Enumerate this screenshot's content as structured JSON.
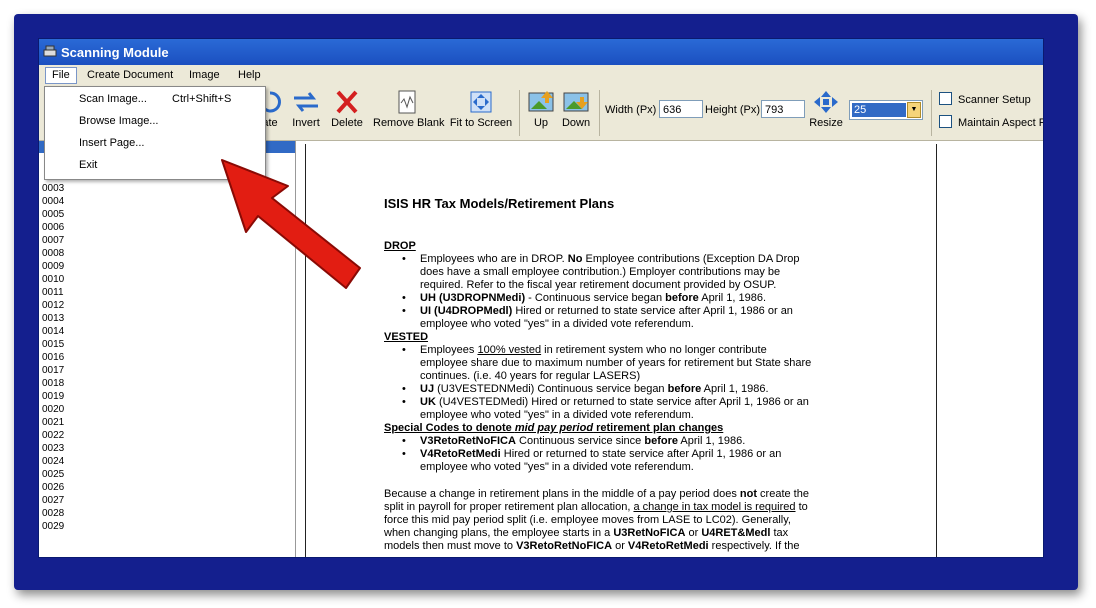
{
  "window": {
    "title": "Scanning Module"
  },
  "menu": {
    "file": "File",
    "create_document": "Create Document",
    "image": "Image",
    "help": "Help"
  },
  "file_menu": {
    "scan_image": "Scan Image...",
    "scan_image_shortcut": "Ctrl+Shift+S",
    "browse_image": "Browse Image...",
    "insert_page": "Insert Page...",
    "exit": "Exit"
  },
  "toolbar": {
    "rotate_partial": "ate",
    "invert": "Invert",
    "delete": "Delete",
    "remove_blank": "Remove Blank",
    "fit_to_screen": "Fit to Screen",
    "up": "Up",
    "down": "Down",
    "width_label": "Width (Px)",
    "width_value": "636",
    "height_label": "Height (Px)",
    "height_value": "793",
    "resize": "Resize",
    "zoom_value": "25",
    "scanner_setup": "Scanner Setup",
    "maintain_aspect": "Maintain Aspect F"
  },
  "page_list": [
    "0003",
    "0004",
    "0005",
    "0006",
    "0007",
    "0008",
    "0009",
    "0010",
    "0011",
    "0012",
    "0013",
    "0014",
    "0015",
    "0016",
    "0017",
    "0018",
    "0019",
    "0020",
    "0021",
    "0022",
    "0023",
    "0024",
    "0025",
    "0026",
    "0027",
    "0028",
    "0029"
  ],
  "document": {
    "title": "ISIS HR Tax Models/Retirement Plans",
    "drop_heading": "DROP",
    "drop_b1_a": "Employees who are in DROP.  ",
    "drop_b1_bold": "No",
    "drop_b1_b": " Employee contributions (Exception DA Drop",
    "drop_b1_l2": "does have a small employee contribution.)  Employer contributions may be",
    "drop_b1_l3": "required.  Refer to the fiscal year retirement document provided by OSUP.",
    "drop_b2_bold": "UH (U3DROPNMedi)",
    "drop_b2_a": " - Continuous service began ",
    "drop_b2_bold2": "before",
    "drop_b2_b": " April 1, 1986.",
    "drop_b3_bold": "UI (U4DROPMedl)",
    "drop_b3_a": " Hired or returned to state service after April 1, 1986 or an",
    "drop_b3_l2": "employee who voted \"yes\" in a divided vote referendum.",
    "vested_heading": "VESTED",
    "vested_b1_a": "Employees ",
    "vested_b1_u": "100% vested",
    "vested_b1_b": " in retirement system who no longer contribute",
    "vested_b1_l2": "employee share due to maximum number of years for retirement but State share",
    "vested_b1_l3": "continues. (i.e. 40 years for regular LASERS)",
    "vested_b2_bold": "UJ",
    "vested_b2_a": " (U3VESTEDNMedi) Continuous service began ",
    "vested_b2_bold2": "before",
    "vested_b2_b": " April 1, 1986.",
    "vested_b3_bold": "UK",
    "vested_b3_a": " (U4VESTEDMedi) Hired or returned to state service after April 1, 1986 or an",
    "vested_b3_l2": "employee who voted \"yes\" in a divided vote referendum.",
    "special_a": "Special Codes to denote ",
    "special_i": "mid pay period",
    "special_b": " retirement plan changes",
    "sp_b1_bold": "V3RetoRetNoFICA",
    "sp_b1_a": " Continuous service since ",
    "sp_b1_bold2": "before",
    "sp_b1_b": " April 1, 1986.",
    "sp_b2_bold": "V4RetoRetMedi",
    "sp_b2_a": " Hired or returned to state service after April 1, 1986 or an",
    "sp_b2_l2": "employee who voted \"yes\" in a divided vote referendum.",
    "para_l1_a": "Because a change in retirement plans in the middle of a pay period does ",
    "para_l1_bold": "not",
    "para_l1_b": " create the",
    "para_l2_a": "split in payroll for proper retirement plan allocation, ",
    "para_l2_u": "a change in tax model is required",
    "para_l2_b": " to",
    "para_l3": "force this mid pay period split (i.e. employee moves from LASE to LC02). Generally,",
    "para_l4_a": "when changing plans, the employee starts in a ",
    "para_l4_bold": "U3RetNoFICA",
    "para_l4_b": " or ",
    "para_l4_bold2": "U4RET&Medl",
    "para_l4_c": " tax",
    "para_l5_a": "models then must move to ",
    "para_l5_bold": "V3RetoRetNoFICA",
    "para_l5_b": " or ",
    "para_l5_bold2": "V4RetoRetMedi",
    "para_l5_c": " respectively. If the"
  },
  "colors": {
    "frame": "#141f8e",
    "titlebar": "#1b4fc0",
    "selection": "#316ac5",
    "arrow": "#e21d12"
  }
}
